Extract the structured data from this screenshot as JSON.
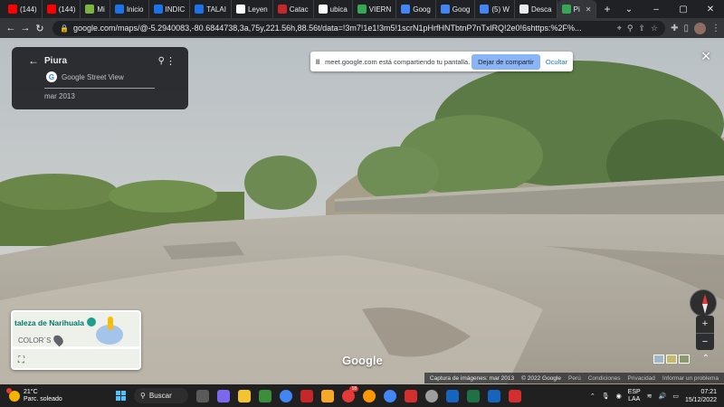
{
  "browser": {
    "tabs": [
      {
        "label": "(144)",
        "color": "#ff0000"
      },
      {
        "label": "(144)",
        "color": "#ff0000"
      },
      {
        "label": "Mi",
        "color": "#7cb342"
      },
      {
        "label": "Inicio",
        "color": "#1a73e8"
      },
      {
        "label": "INDIC",
        "color": "#1a73e8"
      },
      {
        "label": "TALAI",
        "color": "#1a73e8"
      },
      {
        "label": "Leyen",
        "color": "#ffffff"
      },
      {
        "label": "Catac",
        "color": "#c62828"
      },
      {
        "label": "ubica",
        "color": "#ffffff"
      },
      {
        "label": "VIERN",
        "color": "#34a853"
      },
      {
        "label": "Goog",
        "color": "#4285f4"
      },
      {
        "label": "Goog",
        "color": "#4285f4"
      },
      {
        "label": "(5) W",
        "color": "#4285f4"
      },
      {
        "label": "Desca",
        "color": "#e8eaed"
      },
      {
        "label": "Pi",
        "color": "#34a853",
        "active": true
      }
    ],
    "new_tab": "+",
    "url": "google.com/maps/@-5.2940083,-80.6844738,3a,75y,221.56h,88.56t/data=!3m7!1e1!3m5!1scrN1pHrfHNTbtnP7nTxlRQ!2e0!6shttps:%2F%..."
  },
  "infocard": {
    "title": "Piura",
    "source": "Google Street View",
    "date": "mar 2013"
  },
  "sharebar": {
    "message": "meet.google.com está compartiendo tu pantalla.",
    "stop_label": "Dejar de compartir",
    "hide_label": "Ocultar"
  },
  "minimap": {
    "place": "taleza de Narihuala",
    "sublabel": "COLOR´S"
  },
  "viewer": {
    "logo": "Google",
    "footer": {
      "capture": "Captura de imágenes: mar 2013",
      "copyright": "© 2022 Google",
      "country": "Perú",
      "terms": "Condiciones",
      "privacy": "Privacidad",
      "report": "Informar un problema"
    }
  },
  "taskbar": {
    "weather_temp": "21°C",
    "weather_desc": "Parc. soleado",
    "search_label": "Buscar",
    "notif_count": "18",
    "lang_line1": "ESP",
    "lang_line2": "LAA",
    "time": "07:21",
    "date": "15/12/2022"
  }
}
